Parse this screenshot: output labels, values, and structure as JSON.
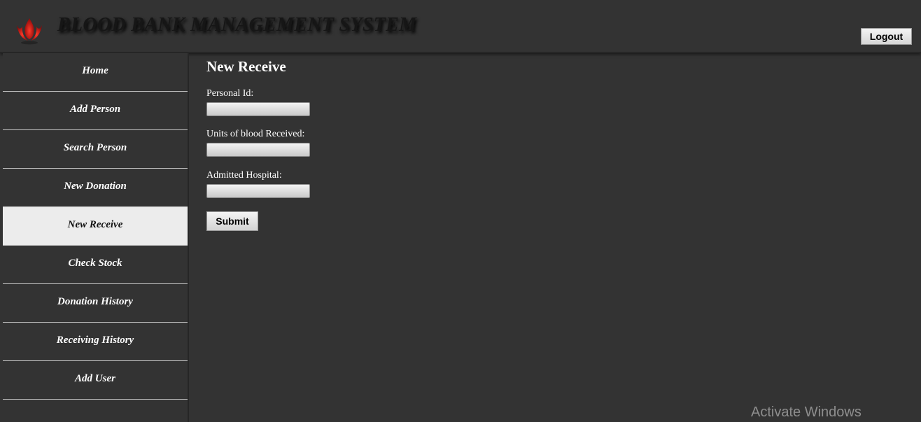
{
  "header": {
    "title": "BLOOD BANK MANAGEMENT SYSTEM",
    "logout_label": "Logout",
    "logo_icon": "blood-drop-flame-logo",
    "logo_color": "#c0181a"
  },
  "sidebar": {
    "active_index": 4,
    "items": [
      {
        "label": "Home"
      },
      {
        "label": "Add Person"
      },
      {
        "label": "Search Person"
      },
      {
        "label": "New Donation"
      },
      {
        "label": "New Receive"
      },
      {
        "label": "Check Stock"
      },
      {
        "label": "Donation History"
      },
      {
        "label": "Receiving History"
      },
      {
        "label": "Add User"
      }
    ]
  },
  "main": {
    "title": "New Receive",
    "fields": [
      {
        "label": "Personal Id:",
        "value": ""
      },
      {
        "label": "Units of blood Received:",
        "value": ""
      },
      {
        "label": "Admitted Hospital:",
        "value": ""
      }
    ],
    "submit_label": "Submit"
  },
  "os": {
    "watermark": "Activate Windows"
  },
  "colors": {
    "background": "#333333",
    "active_nav_bg": "#ececec",
    "text": "#ffffff"
  }
}
